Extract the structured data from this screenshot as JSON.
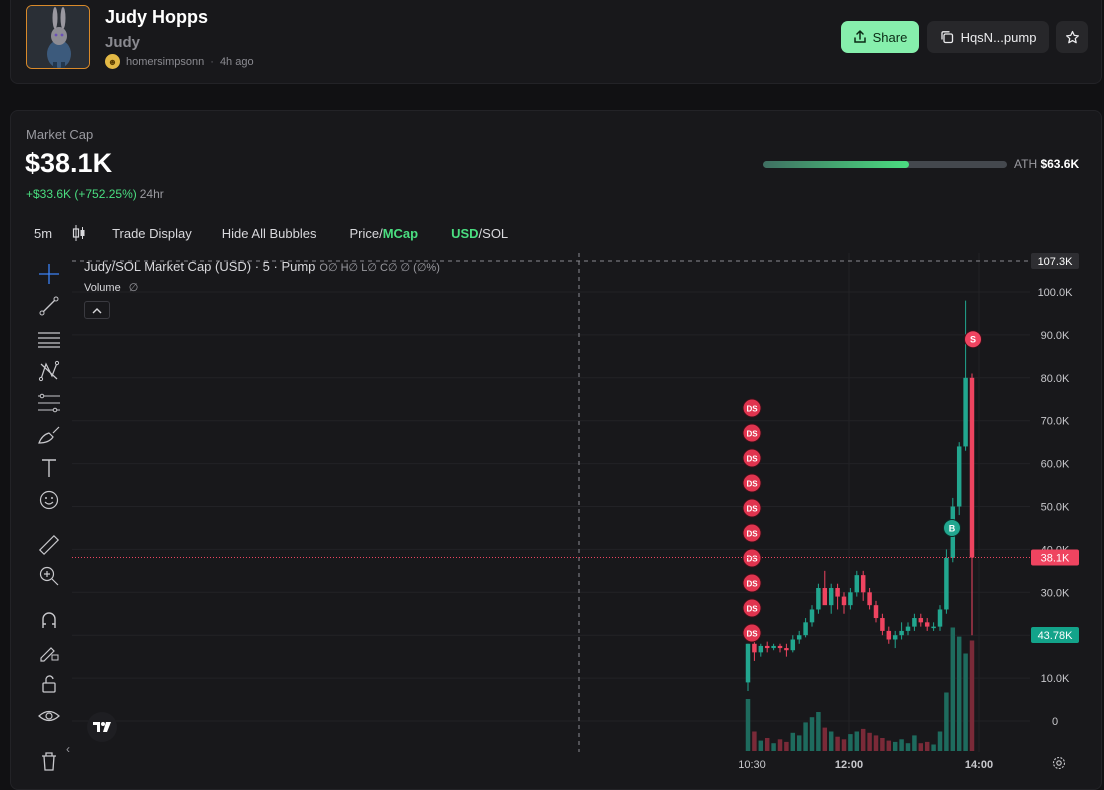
{
  "token": {
    "name": "Judy Hopps",
    "ticker": "Judy",
    "creator": "homersimpsonn",
    "age": "4h ago"
  },
  "actions": {
    "share_label": "Share",
    "contract_label": "HqsN...pump"
  },
  "market": {
    "label": "Market Cap",
    "value": "$38.1K",
    "change": "+$33.6K (+752.25%)",
    "period": "24hr",
    "ath_label": "ATH",
    "ath_value": "$63.6K",
    "ath_progress": 0.6
  },
  "toolbar": {
    "interval": "5m",
    "trade_display": "Trade Display",
    "hide_bubbles": "Hide All Bubbles",
    "price_label": "Price/",
    "mcap_label": "MCap",
    "usd_label": "USD",
    "sol_label": "/SOL"
  },
  "chart": {
    "legend_title": "Judy/SOL Market Cap (USD) · 5 · Pump",
    "legend_ohlc": "O∅ H∅ L∅ C∅ ∅ (∅%)",
    "volume_label": "Volume",
    "volume_value": "∅",
    "y_ticks": [
      "100.0K",
      "90.0K",
      "80.0K",
      "70.0K",
      "60.0K",
      "50.0K",
      "40.0K",
      "30.0K",
      "20.0K",
      "10.0K",
      "0"
    ],
    "x_ticks": [
      "10:30",
      "12:00",
      "14:00"
    ],
    "crosshair_price": "107.3K",
    "last_price": "38.1K",
    "volume_badge": "43.78K",
    "ds_label": "DS",
    "buy_label": "B",
    "sell_label": "S",
    "colors": {
      "up": "#22a68f",
      "down": "#ef4460",
      "accent": "#4ade80"
    }
  },
  "chart_data": {
    "type": "candlestick",
    "title": "Judy/SOL Market Cap (USD) · 5 · Pump",
    "ylim": [
      0,
      110000
    ],
    "y_ticks": [
      0,
      10000,
      20000,
      30000,
      40000,
      50000,
      60000,
      70000,
      80000,
      90000,
      100000
    ],
    "x_ticks": [
      "10:30",
      "12:00",
      "14:00"
    ],
    "candles": [
      {
        "o": 9000,
        "h": 18000,
        "l": 7000,
        "c": 18000
      },
      {
        "o": 18000,
        "h": 19000,
        "l": 14000,
        "c": 16000
      },
      {
        "o": 16000,
        "h": 18000,
        "l": 15000,
        "c": 17500
      },
      {
        "o": 17500,
        "h": 18500,
        "l": 16000,
        "c": 17000
      },
      {
        "o": 17000,
        "h": 18000,
        "l": 16500,
        "c": 17500
      },
      {
        "o": 17500,
        "h": 18000,
        "l": 16000,
        "c": 17000
      },
      {
        "o": 17000,
        "h": 18000,
        "l": 15000,
        "c": 16500
      },
      {
        "o": 16500,
        "h": 20000,
        "l": 16000,
        "c": 19000
      },
      {
        "o": 19000,
        "h": 21000,
        "l": 18000,
        "c": 20000
      },
      {
        "o": 20000,
        "h": 24000,
        "l": 19500,
        "c": 23000
      },
      {
        "o": 23000,
        "h": 27000,
        "l": 22000,
        "c": 26000
      },
      {
        "o": 26000,
        "h": 32000,
        "l": 25000,
        "c": 31000
      },
      {
        "o": 31000,
        "h": 35000,
        "l": 28000,
        "c": 27000
      },
      {
        "o": 27000,
        "h": 32000,
        "l": 25000,
        "c": 31000
      },
      {
        "o": 31000,
        "h": 32000,
        "l": 26000,
        "c": 29000
      },
      {
        "o": 29000,
        "h": 30000,
        "l": 25000,
        "c": 27000
      },
      {
        "o": 27000,
        "h": 31000,
        "l": 26000,
        "c": 30000
      },
      {
        "o": 30000,
        "h": 35000,
        "l": 29000,
        "c": 34000
      },
      {
        "o": 34000,
        "h": 35000,
        "l": 28000,
        "c": 30000
      },
      {
        "o": 30000,
        "h": 31000,
        "l": 26000,
        "c": 27000
      },
      {
        "o": 27000,
        "h": 28000,
        "l": 23000,
        "c": 24000
      },
      {
        "o": 24000,
        "h": 25000,
        "l": 20000,
        "c": 21000
      },
      {
        "o": 21000,
        "h": 22000,
        "l": 18000,
        "c": 19000
      },
      {
        "o": 19000,
        "h": 21000,
        "l": 17000,
        "c": 20000
      },
      {
        "o": 20000,
        "h": 23000,
        "l": 19000,
        "c": 21000
      },
      {
        "o": 21000,
        "h": 23000,
        "l": 20000,
        "c": 22000
      },
      {
        "o": 22000,
        "h": 25000,
        "l": 21000,
        "c": 24000
      },
      {
        "o": 24000,
        "h": 25000,
        "l": 22000,
        "c": 23000
      },
      {
        "o": 23000,
        "h": 24000,
        "l": 21000,
        "c": 22000
      },
      {
        "o": 22000,
        "h": 23000,
        "l": 21000,
        "c": 22000
      },
      {
        "o": 22000,
        "h": 27000,
        "l": 21000,
        "c": 26000
      },
      {
        "o": 26000,
        "h": 40000,
        "l": 25000,
        "c": 38000
      },
      {
        "o": 38000,
        "h": 52000,
        "l": 37000,
        "c": 50000
      },
      {
        "o": 50000,
        "h": 65000,
        "l": 48000,
        "c": 64000
      },
      {
        "o": 64000,
        "h": 98000,
        "l": 63000,
        "c": 80000
      },
      {
        "o": 80000,
        "h": 81000,
        "l": 20000,
        "c": 38100
      }
    ],
    "volume": [
      {
        "v": 4000,
        "up": true
      },
      {
        "v": 1500,
        "up": false
      },
      {
        "v": 800,
        "up": true
      },
      {
        "v": 1000,
        "up": false
      },
      {
        "v": 600,
        "up": true
      },
      {
        "v": 900,
        "up": false
      },
      {
        "v": 700,
        "up": false
      },
      {
        "v": 1400,
        "up": true
      },
      {
        "v": 1200,
        "up": true
      },
      {
        "v": 2200,
        "up": true
      },
      {
        "v": 2600,
        "up": true
      },
      {
        "v": 3000,
        "up": true
      },
      {
        "v": 1800,
        "up": false
      },
      {
        "v": 1500,
        "up": true
      },
      {
        "v": 1100,
        "up": false
      },
      {
        "v": 900,
        "up": false
      },
      {
        "v": 1300,
        "up": true
      },
      {
        "v": 1500,
        "up": true
      },
      {
        "v": 1700,
        "up": false
      },
      {
        "v": 1400,
        "up": false
      },
      {
        "v": 1200,
        "up": false
      },
      {
        "v": 1000,
        "up": false
      },
      {
        "v": 800,
        "up": false
      },
      {
        "v": 700,
        "up": true
      },
      {
        "v": 900,
        "up": true
      },
      {
        "v": 600,
        "up": true
      },
      {
        "v": 1200,
        "up": true
      },
      {
        "v": 600,
        "up": false
      },
      {
        "v": 700,
        "up": false
      },
      {
        "v": 500,
        "up": true
      },
      {
        "v": 1500,
        "up": true
      },
      {
        "v": 4500,
        "up": true
      },
      {
        "v": 9500,
        "up": true
      },
      {
        "v": 8800,
        "up": true
      },
      {
        "v": 7500,
        "up": true
      },
      {
        "v": 8500,
        "up": false
      }
    ],
    "markers": {
      "ds_count": 10,
      "buy": {
        "price": 45000
      },
      "sell": {
        "price": 89000
      }
    }
  }
}
